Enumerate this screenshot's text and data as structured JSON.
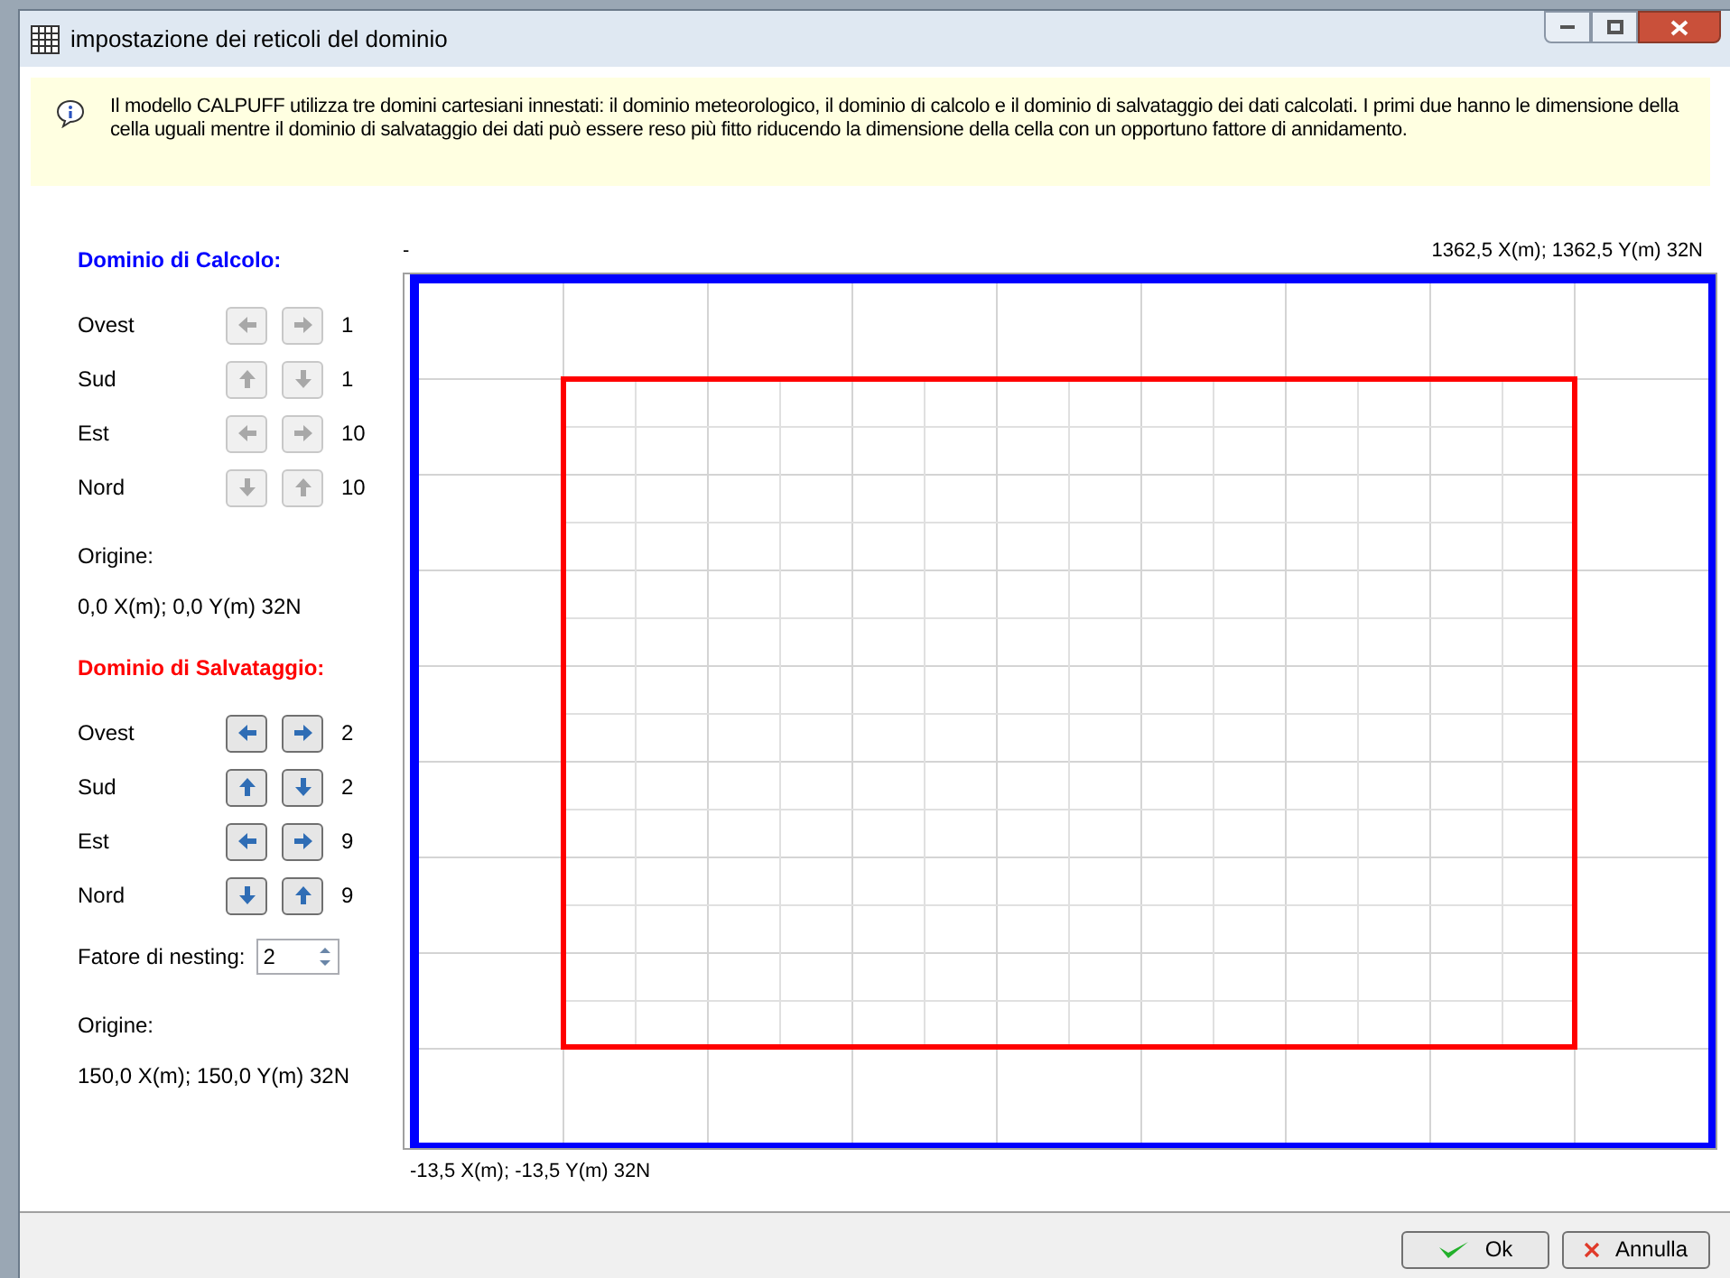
{
  "window": {
    "title": "impostazione dei reticoli del dominio"
  },
  "info": "Il modello CALPUFF utilizza tre domini cartesiani innestati: il dominio meteorologico, il dominio di calcolo e il dominio di salvataggio dei dati calcolati. I primi due hanno le dimensione della cella uguali mentre il dominio di salvataggio dei dati può essere reso più fitto riducendo la dimensione della cella con un opportuno fattore di annidamento.",
  "sections": [
    {
      "title": "Dominio di Calcolo:",
      "color": "#0000ff",
      "rows": [
        {
          "label": "Ovest",
          "buttons": [
            {
              "kind": "left",
              "disabled": true
            },
            {
              "kind": "right",
              "disabled": true
            }
          ],
          "value": "1"
        },
        {
          "label": "Sud",
          "buttons": [
            {
              "kind": "up",
              "disabled": true
            },
            {
              "kind": "down",
              "disabled": true
            }
          ],
          "value": "1"
        },
        {
          "label": "Est",
          "buttons": [
            {
              "kind": "left",
              "disabled": true
            },
            {
              "kind": "right",
              "disabled": true
            }
          ],
          "value": "10"
        },
        {
          "label": "Nord",
          "buttons": [
            {
              "kind": "down",
              "disabled": true
            },
            {
              "kind": "up",
              "disabled": true
            }
          ],
          "value": "10"
        }
      ],
      "origin_label": "Origine:",
      "origin": "0,0 X(m); 0,0 Y(m) 32N"
    },
    {
      "title": "Dominio di Salvataggio:",
      "color": "#ff0000",
      "rows": [
        {
          "label": "Ovest",
          "buttons": [
            {
              "kind": "left",
              "disabled": false
            },
            {
              "kind": "right",
              "disabled": false
            }
          ],
          "value": "2"
        },
        {
          "label": "Sud",
          "buttons": [
            {
              "kind": "up",
              "disabled": false
            },
            {
              "kind": "down",
              "disabled": false
            }
          ],
          "value": "2"
        },
        {
          "label": "Est",
          "buttons": [
            {
              "kind": "left",
              "disabled": false
            },
            {
              "kind": "right",
              "disabled": false
            }
          ],
          "value": "9"
        },
        {
          "label": "Nord",
          "buttons": [
            {
              "kind": "down",
              "disabled": false
            },
            {
              "kind": "up",
              "disabled": false
            }
          ],
          "value": "9"
        }
      ],
      "nesting": {
        "label": "Fatore di nesting:",
        "value": "2"
      },
      "origin_label": "Origine:",
      "origin": "150,0 X(m); 150,0 Y(m) 32N"
    }
  ],
  "map": {
    "top_left": "-",
    "top_right": "1362,5 X(m); 1362,5 Y(m) 32N",
    "bottom_left": "-13,5 X(m); -13,5 Y(m) 32N"
  },
  "buttons": [
    {
      "kind": "ok",
      "label": "Ok"
    },
    {
      "kind": "cancel",
      "label": "Annulla"
    }
  ]
}
